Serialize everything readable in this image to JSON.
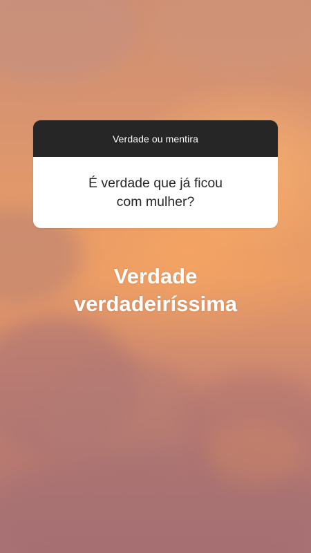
{
  "question_sticker": {
    "title": "Verdade ou mentira",
    "question_line1": "É verdade que já ficou",
    "question_line2": "com mulher?"
  },
  "answer": {
    "line1": "Verdade",
    "line2": "verdadeiríssima"
  },
  "colors": {
    "sticker_header": "#262626",
    "sticker_body": "#ffffff",
    "answer_text": "#ffffff",
    "sky_orange": "#e89b66",
    "cloud_mauve": "#a97274"
  }
}
